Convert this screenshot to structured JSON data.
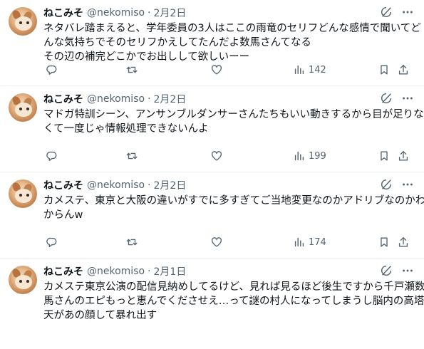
{
  "tweets": [
    {
      "name": "ねこみそ",
      "handle": "@nekomiso",
      "separator": "·",
      "date": "2月2日",
      "lines": [
        "ネタバレ踏まえると、学年委員の3人はここの雨竜のセリフどんな感情で聞いてど",
        "んな気持ちでそのセリフかえしてたんだよ数馬さんてなる",
        "その辺の補完どこかでお出しして欲しいーー"
      ],
      "views": "142"
    },
    {
      "name": "ねこみそ",
      "handle": "@nekomiso",
      "separator": "·",
      "date": "2月2日",
      "lines": [
        "マドガ特訓シーン、アンサンブルダンサーさんたちもいい動きするから目が足りな",
        "くて一度じゃ情報処理できないんよ"
      ],
      "views": "199"
    },
    {
      "name": "ねこみそ",
      "handle": "@nekomiso",
      "separator": "·",
      "date": "2月2日",
      "lines": [
        "カメステ、東京と大阪の違いがすでに多すぎてご当地変更なのかアドリブなのかわ",
        "からんw"
      ],
      "views": "174"
    },
    {
      "name": "ねこみそ",
      "handle": "@nekomiso",
      "separator": "·",
      "date": "2月1日",
      "lines": [
        "カメステ東京公演の配信見納めしてるけど、見れば見るほど後生ですから千戸瀬数",
        "馬さんのエピもっと恵んでくださせえ…って謎の村人になってしまうし脳内の高塔戴",
        "天があの顔して暴れ出す"
      ],
      "views": ""
    }
  ],
  "icons": [
    "grok-icon",
    "more-icon",
    "reply-icon",
    "retweet-icon",
    "like-icon",
    "views-icon",
    "bookmark-icon",
    "share-icon"
  ]
}
